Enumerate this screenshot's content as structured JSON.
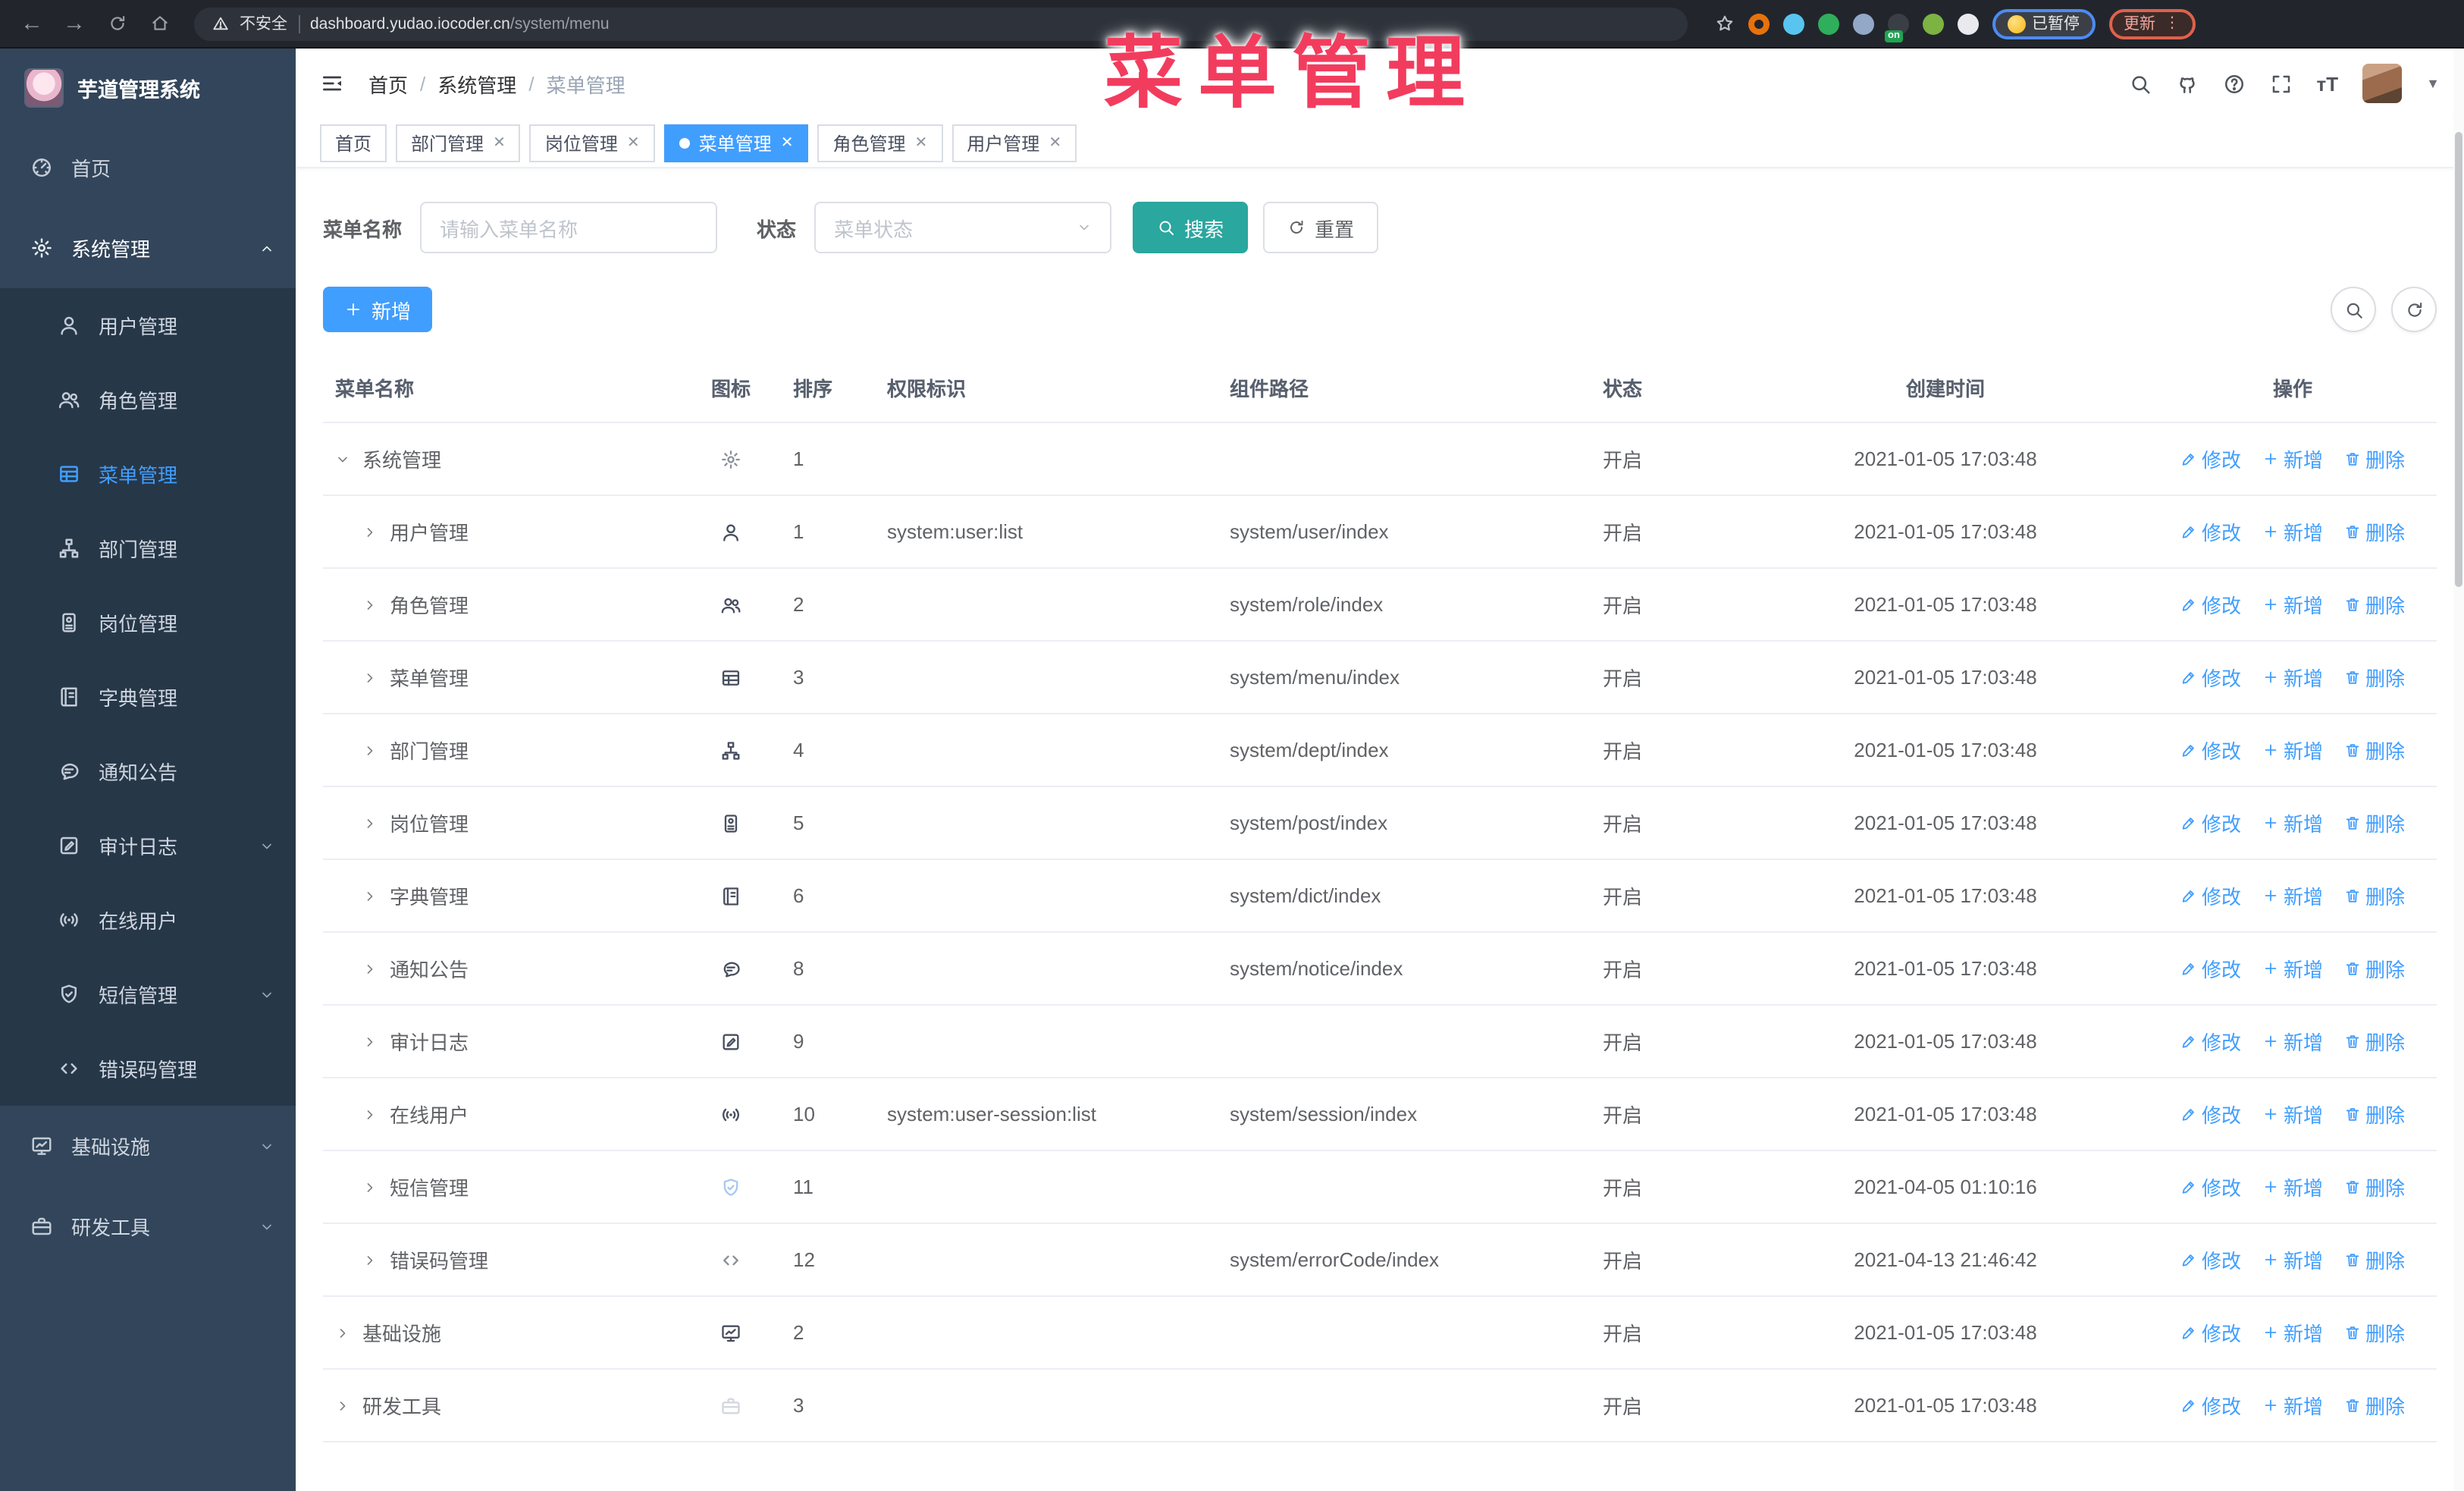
{
  "overlay": {
    "title": "菜单管理"
  },
  "browser": {
    "security_label": "不安全",
    "url_domain": "dashboard.yudao.iocoder.cn",
    "url_path": "/system/menu",
    "paused_badge": "已暂停",
    "update_badge": "更新",
    "update_dots": "⋮",
    "extensions": [
      {
        "name": "ext-orange-ring",
        "color": "#e8710a"
      },
      {
        "name": "ext-blue-gem",
        "color": "#58c5f0"
      },
      {
        "name": "ext-green-check",
        "color": "#2fae5c"
      },
      {
        "name": "ext-columns",
        "color": "#93a8c7"
      },
      {
        "name": "ext-dark-on",
        "color": "#3a3f46",
        "badge": "on"
      },
      {
        "name": "ext-green-monkey",
        "color": "#7cb342"
      },
      {
        "name": "ext-white-puzzle",
        "color": "#e8eaed"
      }
    ]
  },
  "sidebar": {
    "app_title": "芋道管理系统",
    "items": [
      {
        "label": "首页",
        "icon": "dashboard",
        "type": "root"
      },
      {
        "label": "系统管理",
        "icon": "gear",
        "type": "root",
        "active": true,
        "chevron": "up"
      },
      {
        "label": "用户管理",
        "icon": "user",
        "type": "child"
      },
      {
        "label": "角色管理",
        "icon": "users",
        "type": "child"
      },
      {
        "label": "菜单管理",
        "icon": "menulist",
        "type": "child",
        "active": true
      },
      {
        "label": "部门管理",
        "icon": "sitemap",
        "type": "child"
      },
      {
        "label": "岗位管理",
        "icon": "idbadge",
        "type": "child"
      },
      {
        "label": "字典管理",
        "icon": "book",
        "type": "child"
      },
      {
        "label": "通知公告",
        "icon": "message",
        "type": "child"
      },
      {
        "label": "审计日志",
        "icon": "editlog",
        "type": "child",
        "chevron": "down"
      },
      {
        "label": "在线用户",
        "icon": "online",
        "type": "child"
      },
      {
        "label": "短信管理",
        "icon": "shield",
        "type": "child",
        "chevron": "down"
      },
      {
        "label": "错误码管理",
        "icon": "code",
        "type": "child"
      },
      {
        "label": "基础设施",
        "icon": "monitor",
        "type": "root",
        "chevron": "down"
      },
      {
        "label": "研发工具",
        "icon": "toolbox",
        "type": "root",
        "chevron": "down"
      }
    ]
  },
  "header": {
    "breadcrumb": [
      "首页",
      "系统管理",
      "菜单管理"
    ],
    "text_size_label": "тT"
  },
  "tabs": [
    {
      "label": "首页",
      "closable": false,
      "active": false
    },
    {
      "label": "部门管理",
      "closable": true,
      "active": false
    },
    {
      "label": "岗位管理",
      "closable": true,
      "active": false
    },
    {
      "label": "菜单管理",
      "closable": true,
      "active": true
    },
    {
      "label": "角色管理",
      "closable": true,
      "active": false
    },
    {
      "label": "用户管理",
      "closable": true,
      "active": false
    }
  ],
  "filters": {
    "name_label": "菜单名称",
    "name_placeholder": "请输入菜单名称",
    "status_label": "状态",
    "status_placeholder": "菜单状态",
    "search_label": "搜索",
    "reset_label": "重置",
    "add_label": "新增"
  },
  "table": {
    "columns": [
      "菜单名称",
      "图标",
      "排序",
      "权限标识",
      "组件路径",
      "状态",
      "创建时间",
      "操作"
    ],
    "actions": [
      {
        "label": "修改",
        "icon": "pencil"
      },
      {
        "label": "新增",
        "icon": "plus"
      },
      {
        "label": "删除",
        "icon": "trash"
      }
    ],
    "rows": [
      {
        "name": "系统管理",
        "icon": "gear",
        "icon_tone": "mid",
        "level": "root",
        "expanded": true,
        "sort": "1",
        "perm": "",
        "path": "",
        "status": "开启",
        "time": "2021-01-05 17:03:48"
      },
      {
        "name": "用户管理",
        "icon": "user",
        "icon_tone": "",
        "level": "child",
        "expanded": false,
        "sort": "1",
        "perm": "system:user:list",
        "path": "system/user/index",
        "status": "开启",
        "time": "2021-01-05 17:03:48"
      },
      {
        "name": "角色管理",
        "icon": "users",
        "icon_tone": "",
        "level": "child",
        "expanded": false,
        "sort": "2",
        "perm": "",
        "path": "system/role/index",
        "status": "开启",
        "time": "2021-01-05 17:03:48"
      },
      {
        "name": "菜单管理",
        "icon": "menulist",
        "icon_tone": "",
        "level": "child",
        "expanded": false,
        "sort": "3",
        "perm": "",
        "path": "system/menu/index",
        "status": "开启",
        "time": "2021-01-05 17:03:48"
      },
      {
        "name": "部门管理",
        "icon": "sitemap",
        "icon_tone": "",
        "level": "child",
        "expanded": false,
        "sort": "4",
        "perm": "",
        "path": "system/dept/index",
        "status": "开启",
        "time": "2021-01-05 17:03:48"
      },
      {
        "name": "岗位管理",
        "icon": "idbadge",
        "icon_tone": "",
        "level": "child",
        "expanded": false,
        "sort": "5",
        "perm": "",
        "path": "system/post/index",
        "status": "开启",
        "time": "2021-01-05 17:03:48"
      },
      {
        "name": "字典管理",
        "icon": "book",
        "icon_tone": "",
        "level": "child",
        "expanded": false,
        "sort": "6",
        "perm": "",
        "path": "system/dict/index",
        "status": "开启",
        "time": "2021-01-05 17:03:48"
      },
      {
        "name": "通知公告",
        "icon": "message",
        "icon_tone": "",
        "level": "child",
        "expanded": false,
        "sort": "8",
        "perm": "",
        "path": "system/notice/index",
        "status": "开启",
        "time": "2021-01-05 17:03:48"
      },
      {
        "name": "审计日志",
        "icon": "editlog",
        "icon_tone": "",
        "level": "child",
        "expanded": false,
        "sort": "9",
        "perm": "",
        "path": "",
        "status": "开启",
        "time": "2021-01-05 17:03:48"
      },
      {
        "name": "在线用户",
        "icon": "online",
        "icon_tone": "",
        "level": "child",
        "expanded": false,
        "sort": "10",
        "perm": "system:user-session:list",
        "path": "system/session/index",
        "status": "开启",
        "time": "2021-01-05 17:03:48"
      },
      {
        "name": "短信管理",
        "icon": "shield",
        "icon_tone": "light-blue",
        "level": "child",
        "expanded": false,
        "sort": "11",
        "perm": "",
        "path": "",
        "status": "开启",
        "time": "2021-04-05 01:10:16"
      },
      {
        "name": "错误码管理",
        "icon": "code",
        "icon_tone": "mid",
        "level": "child",
        "expanded": false,
        "sort": "12",
        "perm": "",
        "path": "system/errorCode/index",
        "status": "开启",
        "time": "2021-04-13 21:46:42"
      },
      {
        "name": "基础设施",
        "icon": "monitor",
        "icon_tone": "",
        "level": "root",
        "expanded": false,
        "sort": "2",
        "perm": "",
        "path": "",
        "status": "开启",
        "time": "2021-01-05 17:03:48"
      },
      {
        "name": "研发工具",
        "icon": "toolbox",
        "icon_tone": "light-gray",
        "level": "root",
        "expanded": false,
        "sort": "3",
        "perm": "",
        "path": "",
        "status": "开启",
        "time": "2021-01-05 17:03:48"
      }
    ]
  }
}
